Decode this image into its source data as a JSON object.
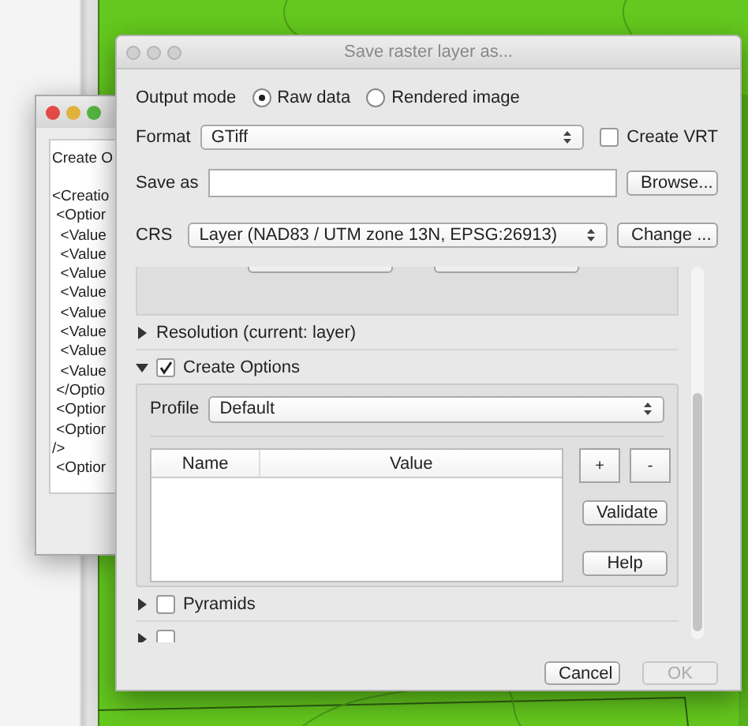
{
  "back_window": {
    "heading": "Create O",
    "lines": [
      "<Creatio",
      " <Optior",
      "  <Value",
      "  <Value",
      "  <Value",
      "  <Value",
      "  <Value",
      "  <Value",
      "  <Value",
      "  <Value",
      " </Optio",
      " <Optior",
      " <Optior",
      "/>",
      " <Optior"
    ]
  },
  "dialog": {
    "title": "Save raster layer as...",
    "output_mode": {
      "label": "Output mode",
      "options": [
        {
          "label": "Raw data",
          "selected": true
        },
        {
          "label": "Rendered image",
          "selected": false
        }
      ]
    },
    "format": {
      "label": "Format",
      "value": "GTiff"
    },
    "create_vrt": {
      "label": "Create VRT",
      "checked": false
    },
    "save_as": {
      "label": "Save as",
      "button": "Browse..."
    },
    "crs": {
      "label": "CRS",
      "value": "Layer (NAD83 / UTM zone 13N, EPSG:26913)",
      "button": "Change ..."
    },
    "sections": [
      {
        "kind": "plain",
        "label": "Resolution (current: layer)",
        "expanded": false
      },
      {
        "kind": "checkable",
        "label": "Create Options",
        "expanded": true,
        "checked": true
      },
      {
        "kind": "checkable",
        "label": "Pyramids",
        "expanded": false,
        "checked": false
      },
      {
        "kind": "checkable",
        "expanded": false,
        "checked": false
      }
    ],
    "create_options": {
      "profile_label": "Profile",
      "profile": "Default",
      "columns": [
        "Name",
        "Value"
      ],
      "add_button": "+",
      "remove_button": "-",
      "validate_button": "Validate",
      "help_button": "Help"
    },
    "buttons": [
      {
        "label": "Cancel",
        "disabled": false
      },
      {
        "label": "OK",
        "disabled": true
      }
    ]
  }
}
